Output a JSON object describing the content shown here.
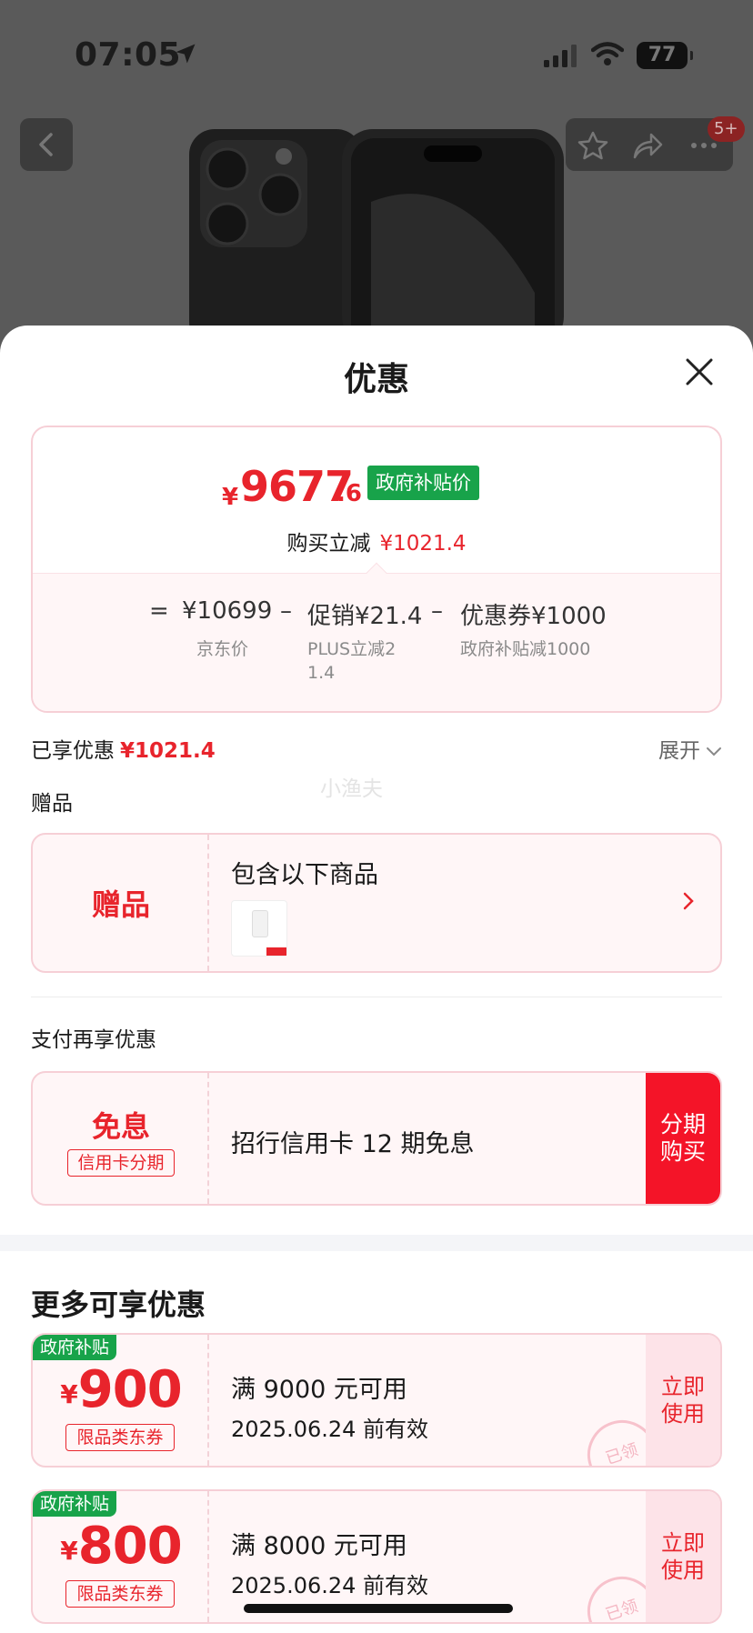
{
  "status_bar": {
    "time": "07:05",
    "battery": "77"
  },
  "header": {
    "badge": "5+"
  },
  "sheet": {
    "title": "优惠",
    "price": {
      "currency": "¥",
      "integer": "9677",
      "decimal": ".6",
      "tag": "政府补贴价",
      "reduce_label": "购买立减",
      "reduce_value": "¥1021.4",
      "calc": {
        "eq": "=",
        "base_value": "¥10699",
        "minus1": "–",
        "promo_value": "促销¥21.4",
        "minus2": "–",
        "coupon_value": "优惠券¥1000",
        "base_label": "京东价",
        "promo_label": "PLUS立减21.4",
        "coupon_label": "政府补贴减1000"
      }
    },
    "saved": {
      "label": "已享优惠",
      "value": "¥1021.4",
      "expand": "展开"
    },
    "watermark": "小渔夫",
    "gift": {
      "section_label": "赠品",
      "card_label": "赠品",
      "desc": "包含以下商品"
    },
    "payment": {
      "section_label": "支付再享优惠",
      "big": "免息",
      "pill": "信用卡分期",
      "desc": "招行信用卡 12 期免息",
      "button_line1": "分期",
      "button_line2": "购买"
    },
    "more": {
      "title": "更多可享优惠",
      "coupons": [
        {
          "tag": "政府补贴",
          "currency": "¥",
          "amount": "900",
          "category": "限品类东券",
          "condition": "满 9000 元可用",
          "validity": "2025.06.24 前有效",
          "use_line1": "立即",
          "use_line2": "使用",
          "stamp": "已领"
        },
        {
          "tag": "政府补贴",
          "currency": "¥",
          "amount": "800",
          "category": "限品类东券",
          "condition": "满 8000 元可用",
          "validity": "2025.06.24 前有效",
          "use_line1": "立即",
          "use_line2": "使用",
          "stamp": "已领"
        }
      ]
    }
  },
  "colors": {
    "accent_red": "#e8242c",
    "gov_green": "#18a34a",
    "card_bg": "#fff6f7",
    "card_border": "#f6cfd6"
  }
}
